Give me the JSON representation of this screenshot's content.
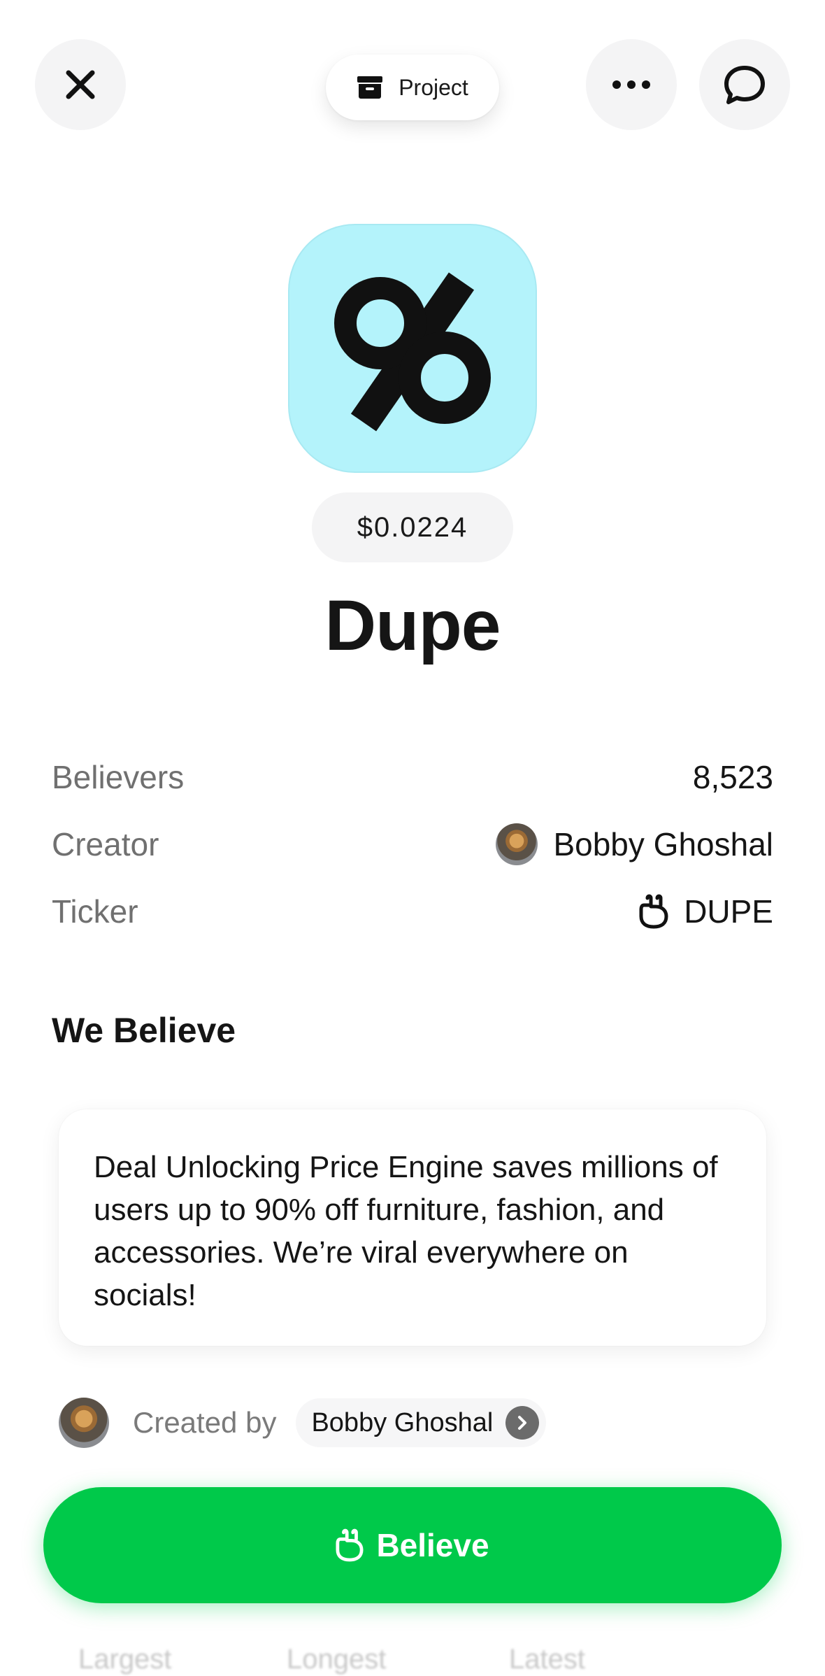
{
  "header": {
    "context_label": "Project",
    "icons": {
      "close": "close-icon",
      "context": "archive-box-icon",
      "more": "more-dots-icon",
      "comment": "comment-bubble-icon"
    }
  },
  "project": {
    "price": "$0.0224",
    "name": "Dupe",
    "icon_color": "#b4f3fb",
    "icon_glyph": "percent-icon"
  },
  "stats": [
    {
      "label": "Believers",
      "value": "8,523"
    },
    {
      "label": "Creator",
      "value": "Bobby Ghoshal"
    },
    {
      "label": "Ticker",
      "value": "DUPE"
    }
  ],
  "section": {
    "title": "We Believe",
    "description": "Deal Unlocking Price Engine saves millions of users up to 90% off furniture, fashion, and accessories. We’re viral everywhere on socials!"
  },
  "created_by": {
    "label": "Created by",
    "name": "Bobby Ghoshal"
  },
  "cta": {
    "label": "Believe",
    "color": "#00c94a"
  },
  "tabs": [
    "Largest",
    "Longest",
    "Latest"
  ]
}
